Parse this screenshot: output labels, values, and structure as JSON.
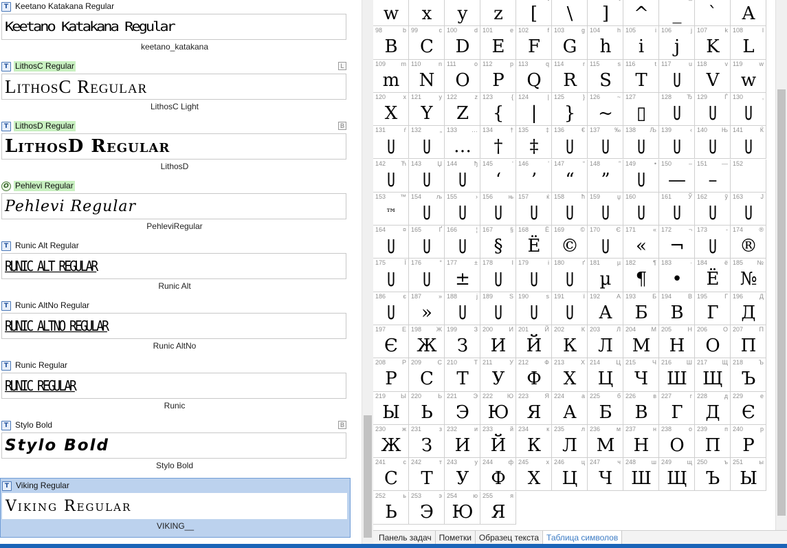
{
  "fonts": [
    {
      "name": "Keetano Katakana Regular",
      "sample": "Keetano Katakana Regular",
      "family": "keetano_katakana",
      "icon": "truetype-icon",
      "icon_glyph": "T",
      "highlight": false,
      "badge": "",
      "style_class": "s-keetano",
      "selected": false
    },
    {
      "name": "LithosC Regular",
      "sample": "LithosC Regular",
      "family": "LithosC Light",
      "icon": "truetype-icon",
      "icon_glyph": "T",
      "highlight": true,
      "badge": "L",
      "style_class": "s-lithosc",
      "selected": false
    },
    {
      "name": "LithosD Regular",
      "sample": "LithosD Regular",
      "family": "LithosD",
      "icon": "truetype-icon",
      "icon_glyph": "T",
      "highlight": true,
      "badge": "B",
      "style_class": "s-lithosd",
      "selected": false
    },
    {
      "name": "Pehlevi Regular",
      "sample": "Pehlevi Regular",
      "family": "PehleviRegular",
      "icon": "opentype-icon",
      "icon_glyph": "O",
      "highlight": true,
      "badge": "",
      "style_class": "s-pehlevi",
      "selected": false
    },
    {
      "name": "Runic Alt Regular",
      "sample": "RUNIC ALT REGULAR",
      "family": "Runic Alt",
      "icon": "truetype-icon",
      "icon_glyph": "T",
      "highlight": false,
      "badge": "",
      "style_class": "s-runic",
      "selected": false
    },
    {
      "name": "Runic AltNo Regular",
      "sample": "RUNIC ALTNO REGULAR",
      "family": "Runic AltNo",
      "icon": "truetype-icon",
      "icon_glyph": "T",
      "highlight": false,
      "badge": "",
      "style_class": "s-runic",
      "selected": false
    },
    {
      "name": "Runic Regular",
      "sample": "RUNIC REGULAR",
      "family": "Runic",
      "icon": "truetype-icon",
      "icon_glyph": "T",
      "highlight": false,
      "badge": "",
      "style_class": "s-runic",
      "selected": false
    },
    {
      "name": "Stylo Bold",
      "sample": "Stylo Bold",
      "family": "Stylo Bold",
      "icon": "truetype-icon",
      "icon_glyph": "T",
      "highlight": false,
      "badge": "B",
      "style_class": "s-stylo",
      "selected": false
    },
    {
      "name": "Viking Regular",
      "sample": "Viking Regular",
      "family": "VIKING__",
      "icon": "truetype-icon",
      "icon_glyph": "T",
      "highlight": false,
      "badge": "",
      "style_class": "s-viking",
      "selected": true
    }
  ],
  "glyph_rows": [
    [
      {
        "code": "87",
        "char": "W",
        "glyph": "w"
      },
      {
        "code": "88",
        "char": "X",
        "glyph": "x"
      },
      {
        "code": "89",
        "char": "Y",
        "glyph": "y"
      },
      {
        "code": "90",
        "char": "Z",
        "glyph": "z"
      },
      {
        "code": "91",
        "char": "[",
        "glyph": "["
      },
      {
        "code": "92",
        "char": "\\",
        "glyph": "\\"
      },
      {
        "code": "93",
        "char": "]",
        "glyph": "]"
      },
      {
        "code": "94",
        "char": "^",
        "glyph": "^"
      },
      {
        "code": "95",
        "char": "_",
        "glyph": "_"
      },
      {
        "code": "96",
        "char": "`",
        "glyph": "`"
      },
      {
        "code": "97",
        "char": "a",
        "glyph": "A"
      }
    ],
    [
      {
        "code": "98",
        "char": "b",
        "glyph": "B"
      },
      {
        "code": "99",
        "char": "c",
        "glyph": "C"
      },
      {
        "code": "100",
        "char": "d",
        "glyph": "D"
      },
      {
        "code": "101",
        "char": "e",
        "glyph": "E"
      },
      {
        "code": "102",
        "char": "f",
        "glyph": "F"
      },
      {
        "code": "103",
        "char": "g",
        "glyph": "G"
      },
      {
        "code": "104",
        "char": "h",
        "glyph": "h"
      },
      {
        "code": "105",
        "char": "i",
        "glyph": "i"
      },
      {
        "code": "106",
        "char": "j",
        "glyph": "j"
      },
      {
        "code": "107",
        "char": "k",
        "glyph": "K"
      },
      {
        "code": "108",
        "char": "l",
        "glyph": "L"
      }
    ],
    [
      {
        "code": "109",
        "char": "m",
        "glyph": "m"
      },
      {
        "code": "110",
        "char": "n",
        "glyph": "N"
      },
      {
        "code": "111",
        "char": "o",
        "glyph": "O"
      },
      {
        "code": "112",
        "char": "p",
        "glyph": "P"
      },
      {
        "code": "113",
        "char": "q",
        "glyph": "Q"
      },
      {
        "code": "114",
        "char": "r",
        "glyph": "R"
      },
      {
        "code": "115",
        "char": "s",
        "glyph": "S"
      },
      {
        "code": "116",
        "char": "t",
        "glyph": "T"
      },
      {
        "code": "117",
        "char": "u",
        "glyph": "U"
      },
      {
        "code": "118",
        "char": "v",
        "glyph": "V"
      },
      {
        "code": "119",
        "char": "w",
        "glyph": "w"
      }
    ],
    [
      {
        "code": "120",
        "char": "x",
        "glyph": "X"
      },
      {
        "code": "121",
        "char": "y",
        "glyph": "Y"
      },
      {
        "code": "122",
        "char": "z",
        "glyph": "Z"
      },
      {
        "code": "123",
        "char": "{",
        "glyph": "{"
      },
      {
        "code": "124",
        "char": "|",
        "glyph": "|"
      },
      {
        "code": "125",
        "char": "}",
        "glyph": "}"
      },
      {
        "code": "126",
        "char": "~",
        "glyph": "~"
      },
      {
        "code": "127",
        "char": "",
        "glyph": "▯"
      },
      {
        "code": "128",
        "char": "Ђ",
        "glyph": "U"
      },
      {
        "code": "129",
        "char": "Ѓ",
        "glyph": "U"
      },
      {
        "code": "130",
        "char": "‚",
        "glyph": "U"
      }
    ],
    [
      {
        "code": "131",
        "char": "ѓ",
        "glyph": "U"
      },
      {
        "code": "132",
        "char": "„",
        "glyph": "U"
      },
      {
        "code": "133",
        "char": "…",
        "glyph": "…"
      },
      {
        "code": "134",
        "char": "†",
        "glyph": "†"
      },
      {
        "code": "135",
        "char": "‡",
        "glyph": "‡"
      },
      {
        "code": "136",
        "char": "€",
        "glyph": "U"
      },
      {
        "code": "137",
        "char": "‰",
        "glyph": "U"
      },
      {
        "code": "138",
        "char": "Љ",
        "glyph": "U"
      },
      {
        "code": "139",
        "char": "‹",
        "glyph": "U"
      },
      {
        "code": "140",
        "char": "Њ",
        "glyph": "U"
      },
      {
        "code": "141",
        "char": "Ќ",
        "glyph": "U"
      }
    ],
    [
      {
        "code": "142",
        "char": "Ћ",
        "glyph": "U"
      },
      {
        "code": "143",
        "char": "Џ",
        "glyph": "U"
      },
      {
        "code": "144",
        "char": "ђ",
        "glyph": "U"
      },
      {
        "code": "145",
        "char": "‘",
        "glyph": "‘"
      },
      {
        "code": "146",
        "char": "’",
        "glyph": "’"
      },
      {
        "code": "147",
        "char": "“",
        "glyph": "“"
      },
      {
        "code": "148",
        "char": "”",
        "glyph": "”"
      },
      {
        "code": "149",
        "char": "•",
        "glyph": "U"
      },
      {
        "code": "150",
        "char": "–",
        "glyph": "—"
      },
      {
        "code": "151",
        "char": "—",
        "glyph": "–"
      },
      {
        "code": "152",
        "char": "",
        "glyph": ""
      }
    ],
    [
      {
        "code": "153",
        "char": "™",
        "glyph": "™"
      },
      {
        "code": "154",
        "char": "љ",
        "glyph": "U"
      },
      {
        "code": "155",
        "char": "›",
        "glyph": "U"
      },
      {
        "code": "156",
        "char": "њ",
        "glyph": "U"
      },
      {
        "code": "157",
        "char": "ќ",
        "glyph": "U"
      },
      {
        "code": "158",
        "char": "ћ",
        "glyph": "U"
      },
      {
        "code": "159",
        "char": "џ",
        "glyph": "U"
      },
      {
        "code": "160",
        "char": "",
        "glyph": "U"
      },
      {
        "code": "161",
        "char": "Ў",
        "glyph": "U"
      },
      {
        "code": "162",
        "char": "ў",
        "glyph": "U"
      },
      {
        "code": "163",
        "char": "Ј",
        "glyph": "U"
      }
    ],
    [
      {
        "code": "164",
        "char": "¤",
        "glyph": "U"
      },
      {
        "code": "165",
        "char": "Ґ",
        "glyph": "U"
      },
      {
        "code": "166",
        "char": "¦",
        "glyph": "U"
      },
      {
        "code": "167",
        "char": "§",
        "glyph": "§"
      },
      {
        "code": "168",
        "char": "Ё",
        "glyph": "Ë"
      },
      {
        "code": "169",
        "char": "©",
        "glyph": "©"
      },
      {
        "code": "170",
        "char": "Є",
        "glyph": "U"
      },
      {
        "code": "171",
        "char": "«",
        "glyph": "«"
      },
      {
        "code": "172",
        "char": "¬",
        "glyph": "¬"
      },
      {
        "code": "173",
        "char": "-",
        "glyph": "U"
      },
      {
        "code": "174",
        "char": "®",
        "glyph": "®"
      }
    ],
    [
      {
        "code": "175",
        "char": "Ї",
        "glyph": "U"
      },
      {
        "code": "176",
        "char": "°",
        "glyph": "U"
      },
      {
        "code": "177",
        "char": "±",
        "glyph": "±"
      },
      {
        "code": "178",
        "char": "І",
        "glyph": "U"
      },
      {
        "code": "179",
        "char": "і",
        "glyph": "U"
      },
      {
        "code": "180",
        "char": "ґ",
        "glyph": "U"
      },
      {
        "code": "181",
        "char": "µ",
        "glyph": "µ"
      },
      {
        "code": "182",
        "char": "¶",
        "glyph": "¶"
      },
      {
        "code": "183",
        "char": "·",
        "glyph": "•"
      },
      {
        "code": "184",
        "char": "ё",
        "glyph": "Ë"
      },
      {
        "code": "185",
        "char": "№",
        "glyph": "№"
      }
    ],
    [
      {
        "code": "186",
        "char": "є",
        "glyph": "U"
      },
      {
        "code": "187",
        "char": "»",
        "glyph": "»"
      },
      {
        "code": "188",
        "char": "ј",
        "glyph": "U"
      },
      {
        "code": "189",
        "char": "Ѕ",
        "glyph": "U"
      },
      {
        "code": "190",
        "char": "ѕ",
        "glyph": "U"
      },
      {
        "code": "191",
        "char": "ї",
        "glyph": "U"
      },
      {
        "code": "192",
        "char": "А",
        "glyph": "А"
      },
      {
        "code": "193",
        "char": "Б",
        "glyph": "Б"
      },
      {
        "code": "194",
        "char": "В",
        "glyph": "В"
      },
      {
        "code": "195",
        "char": "Г",
        "glyph": "Г"
      },
      {
        "code": "196",
        "char": "Д",
        "glyph": "Д"
      }
    ],
    [
      {
        "code": "197",
        "char": "Е",
        "glyph": "Є"
      },
      {
        "code": "198",
        "char": "Ж",
        "glyph": "Ж"
      },
      {
        "code": "199",
        "char": "З",
        "glyph": "З"
      },
      {
        "code": "200",
        "char": "И",
        "glyph": "И"
      },
      {
        "code": "201",
        "char": "Й",
        "glyph": "Й"
      },
      {
        "code": "202",
        "char": "К",
        "glyph": "К"
      },
      {
        "code": "203",
        "char": "Л",
        "glyph": "Л"
      },
      {
        "code": "204",
        "char": "М",
        "glyph": "М"
      },
      {
        "code": "205",
        "char": "Н",
        "glyph": "Н"
      },
      {
        "code": "206",
        "char": "О",
        "glyph": "О"
      },
      {
        "code": "207",
        "char": "П",
        "glyph": "П"
      }
    ],
    [
      {
        "code": "208",
        "char": "Р",
        "glyph": "Р"
      },
      {
        "code": "209",
        "char": "С",
        "glyph": "С"
      },
      {
        "code": "210",
        "char": "Т",
        "glyph": "Т"
      },
      {
        "code": "211",
        "char": "У",
        "glyph": "У"
      },
      {
        "code": "212",
        "char": "Ф",
        "glyph": "Ф"
      },
      {
        "code": "213",
        "char": "Х",
        "glyph": "Х"
      },
      {
        "code": "214",
        "char": "Ц",
        "glyph": "Ц"
      },
      {
        "code": "215",
        "char": "Ч",
        "glyph": "Ч"
      },
      {
        "code": "216",
        "char": "Ш",
        "glyph": "Ш"
      },
      {
        "code": "217",
        "char": "Щ",
        "glyph": "Щ"
      },
      {
        "code": "218",
        "char": "Ъ",
        "glyph": "Ъ"
      }
    ],
    [
      {
        "code": "219",
        "char": "Ы",
        "glyph": "Ы"
      },
      {
        "code": "220",
        "char": "Ь",
        "glyph": "Ь"
      },
      {
        "code": "221",
        "char": "Э",
        "glyph": "Э"
      },
      {
        "code": "222",
        "char": "Ю",
        "glyph": "Ю"
      },
      {
        "code": "223",
        "char": "Я",
        "glyph": "Я"
      },
      {
        "code": "224",
        "char": "а",
        "glyph": "А"
      },
      {
        "code": "225",
        "char": "б",
        "glyph": "Б"
      },
      {
        "code": "226",
        "char": "в",
        "glyph": "В"
      },
      {
        "code": "227",
        "char": "г",
        "glyph": "Г"
      },
      {
        "code": "228",
        "char": "д",
        "glyph": "Д"
      },
      {
        "code": "229",
        "char": "е",
        "glyph": "Є"
      }
    ],
    [
      {
        "code": "230",
        "char": "ж",
        "glyph": "Ж"
      },
      {
        "code": "231",
        "char": "з",
        "glyph": "З"
      },
      {
        "code": "232",
        "char": "и",
        "glyph": "И"
      },
      {
        "code": "233",
        "char": "й",
        "glyph": "Й"
      },
      {
        "code": "234",
        "char": "к",
        "glyph": "К"
      },
      {
        "code": "235",
        "char": "л",
        "glyph": "Л"
      },
      {
        "code": "236",
        "char": "м",
        "glyph": "М"
      },
      {
        "code": "237",
        "char": "н",
        "glyph": "Н"
      },
      {
        "code": "238",
        "char": "о",
        "glyph": "О"
      },
      {
        "code": "239",
        "char": "п",
        "glyph": "П"
      },
      {
        "code": "240",
        "char": "р",
        "glyph": "Р"
      }
    ],
    [
      {
        "code": "241",
        "char": "с",
        "glyph": "С"
      },
      {
        "code": "242",
        "char": "т",
        "glyph": "Т"
      },
      {
        "code": "243",
        "char": "у",
        "glyph": "У"
      },
      {
        "code": "244",
        "char": "ф",
        "glyph": "Ф"
      },
      {
        "code": "245",
        "char": "х",
        "glyph": "Х"
      },
      {
        "code": "246",
        "char": "ц",
        "glyph": "Ц"
      },
      {
        "code": "247",
        "char": "ч",
        "glyph": "Ч"
      },
      {
        "code": "248",
        "char": "ш",
        "glyph": "Ш"
      },
      {
        "code": "249",
        "char": "щ",
        "glyph": "Щ"
      },
      {
        "code": "250",
        "char": "ъ",
        "glyph": "Ъ"
      },
      {
        "code": "251",
        "char": "ы",
        "glyph": "Ы"
      }
    ],
    [
      {
        "code": "252",
        "char": "ь",
        "glyph": "Ь"
      },
      {
        "code": "253",
        "char": "э",
        "glyph": "Э"
      },
      {
        "code": "254",
        "char": "ю",
        "glyph": "Ю"
      },
      {
        "code": "255",
        "char": "я",
        "glyph": "Я"
      }
    ]
  ],
  "tabs": [
    {
      "label": "Панель задач",
      "active": false
    },
    {
      "label": "Пометки",
      "active": false
    },
    {
      "label": "Образец текста",
      "active": false
    },
    {
      "label": "Таблица символов",
      "active": true
    }
  ],
  "colors": {
    "selection": "#bcd2ee",
    "highlight": "#c8f0c0",
    "accent_tab": "#3b7bc4",
    "status_strip": "#1a64b8"
  }
}
